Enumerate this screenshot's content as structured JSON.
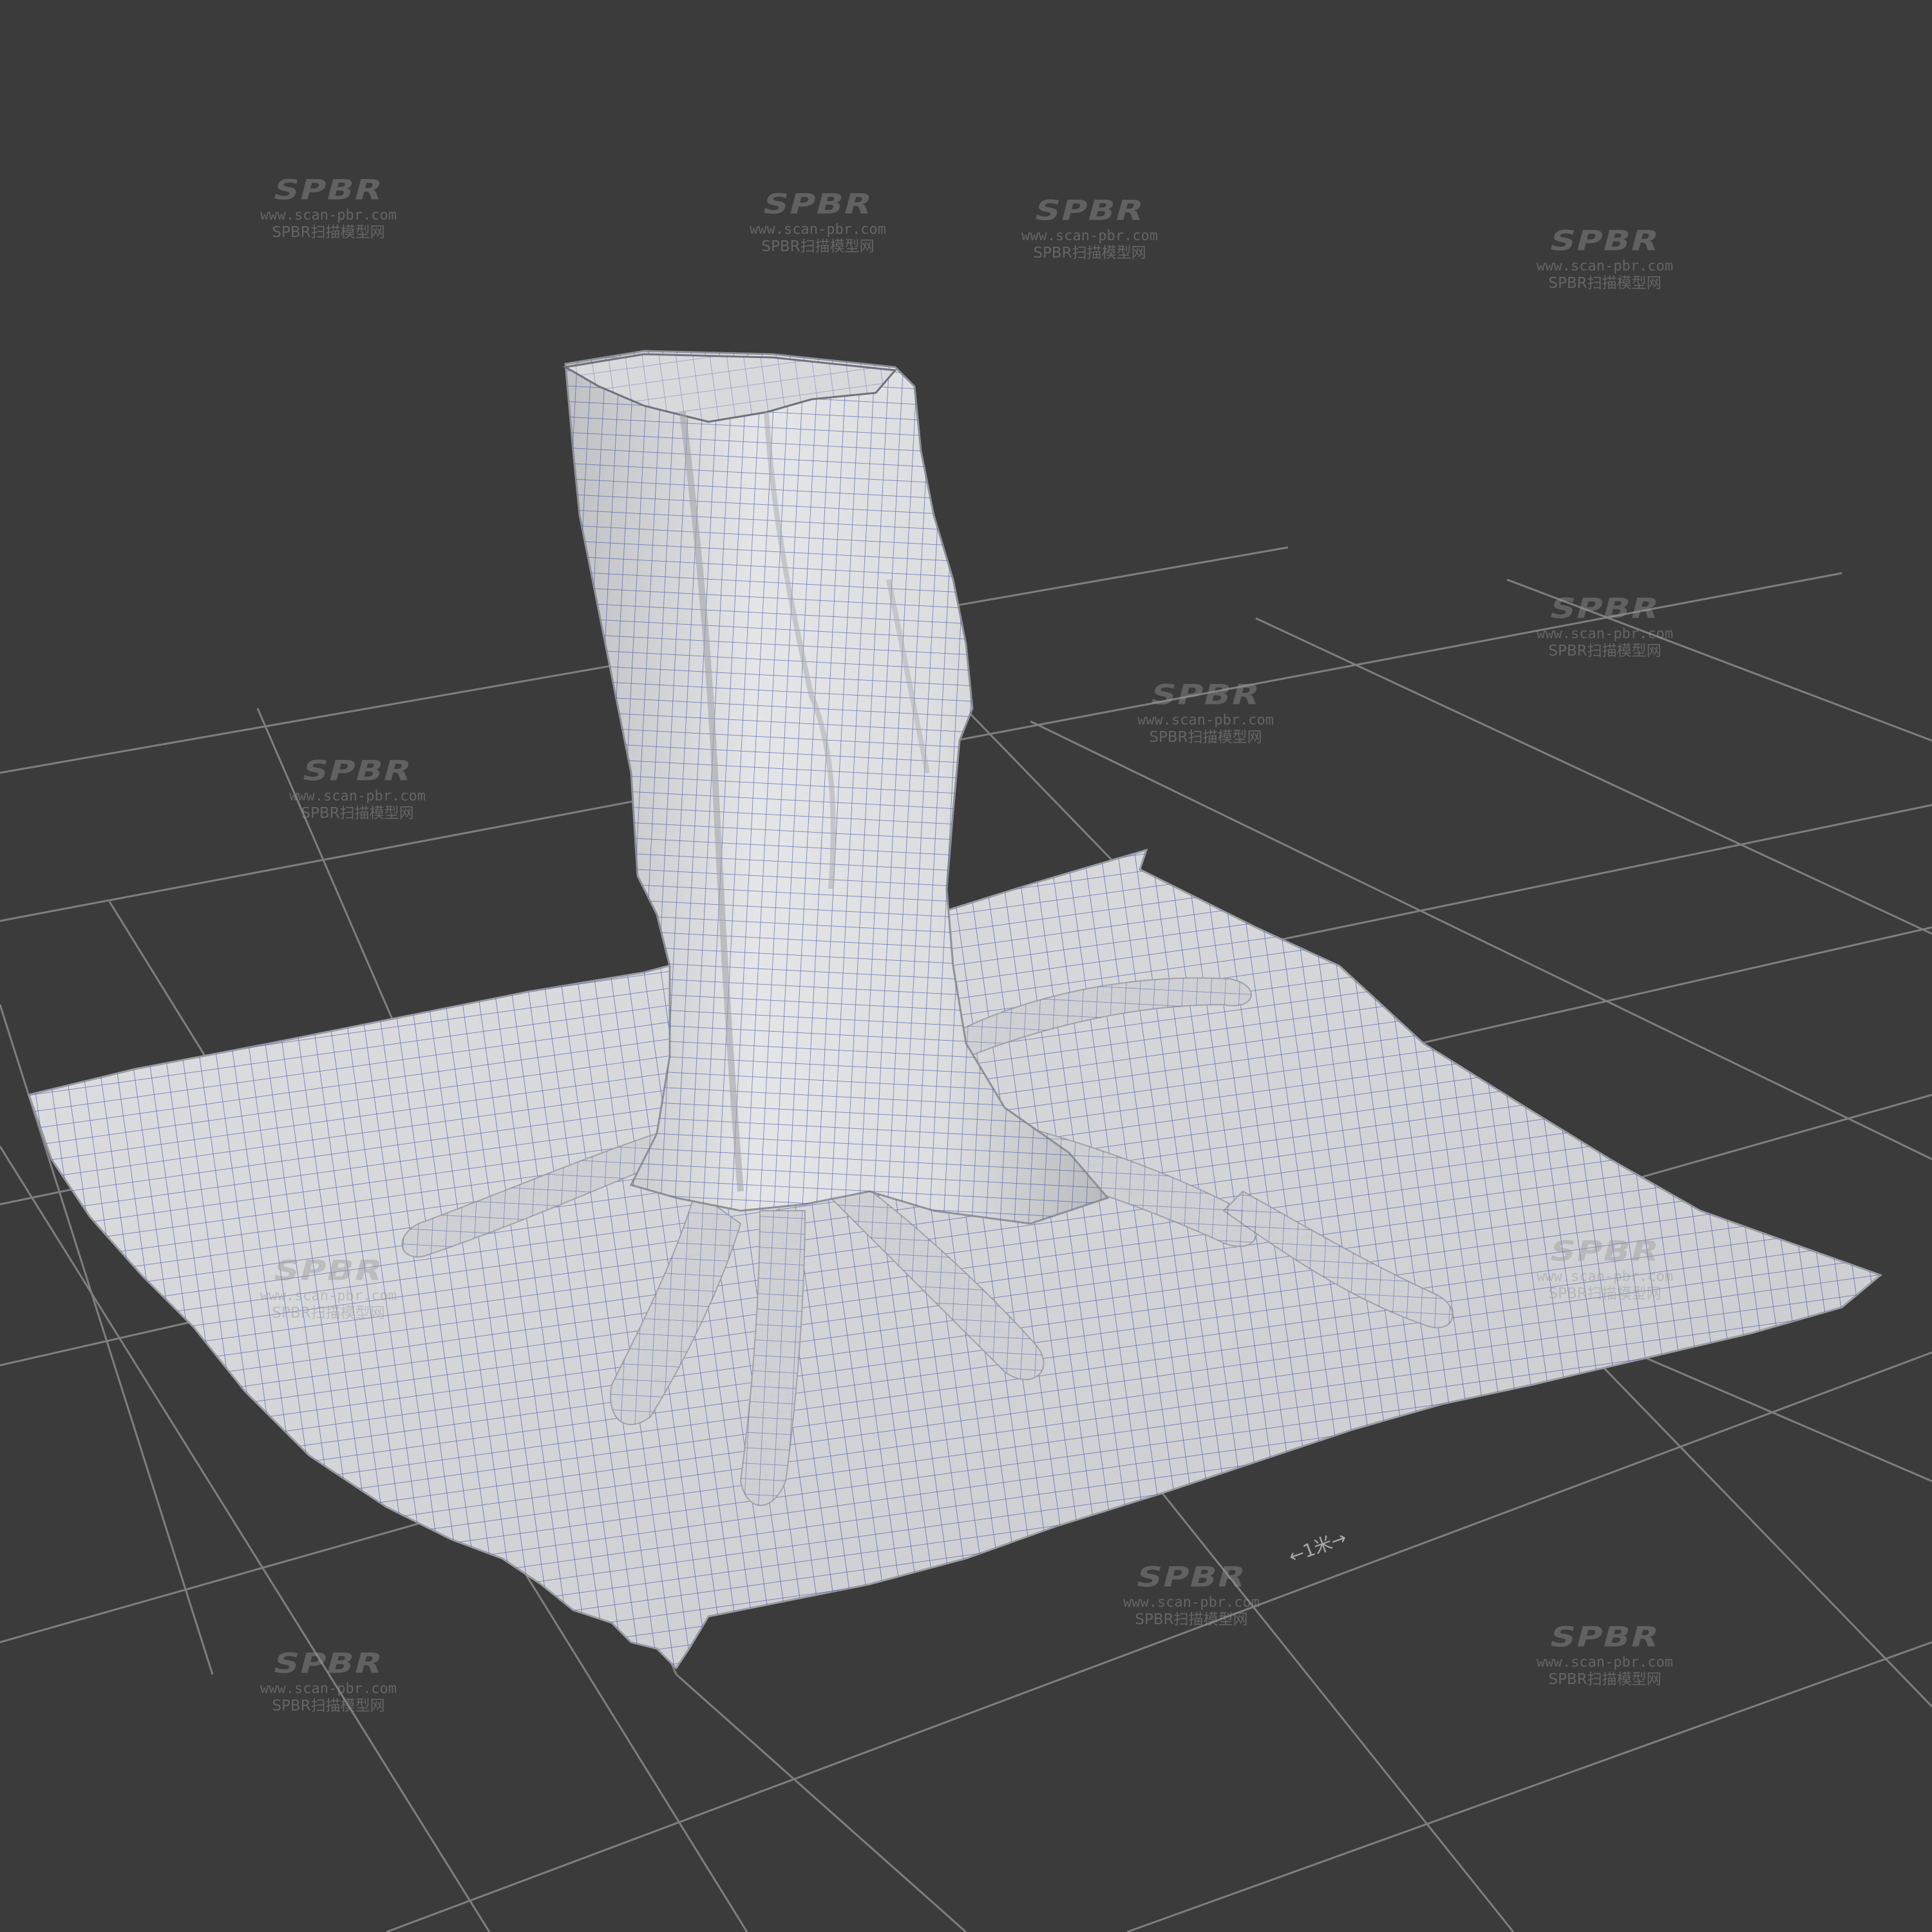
{
  "viewport": {
    "background_color": "#3b3b3b",
    "grid_line_color": "#8a8a8a",
    "mesh_fill_color": "#d9dadc",
    "wire_color": "#3b4ea8"
  },
  "scale_indicator": {
    "label": "←1米→"
  },
  "watermark": {
    "logo": "SPBR",
    "url": "www.scan-pbr.com",
    "text": "SPBR扫描模型网"
  }
}
